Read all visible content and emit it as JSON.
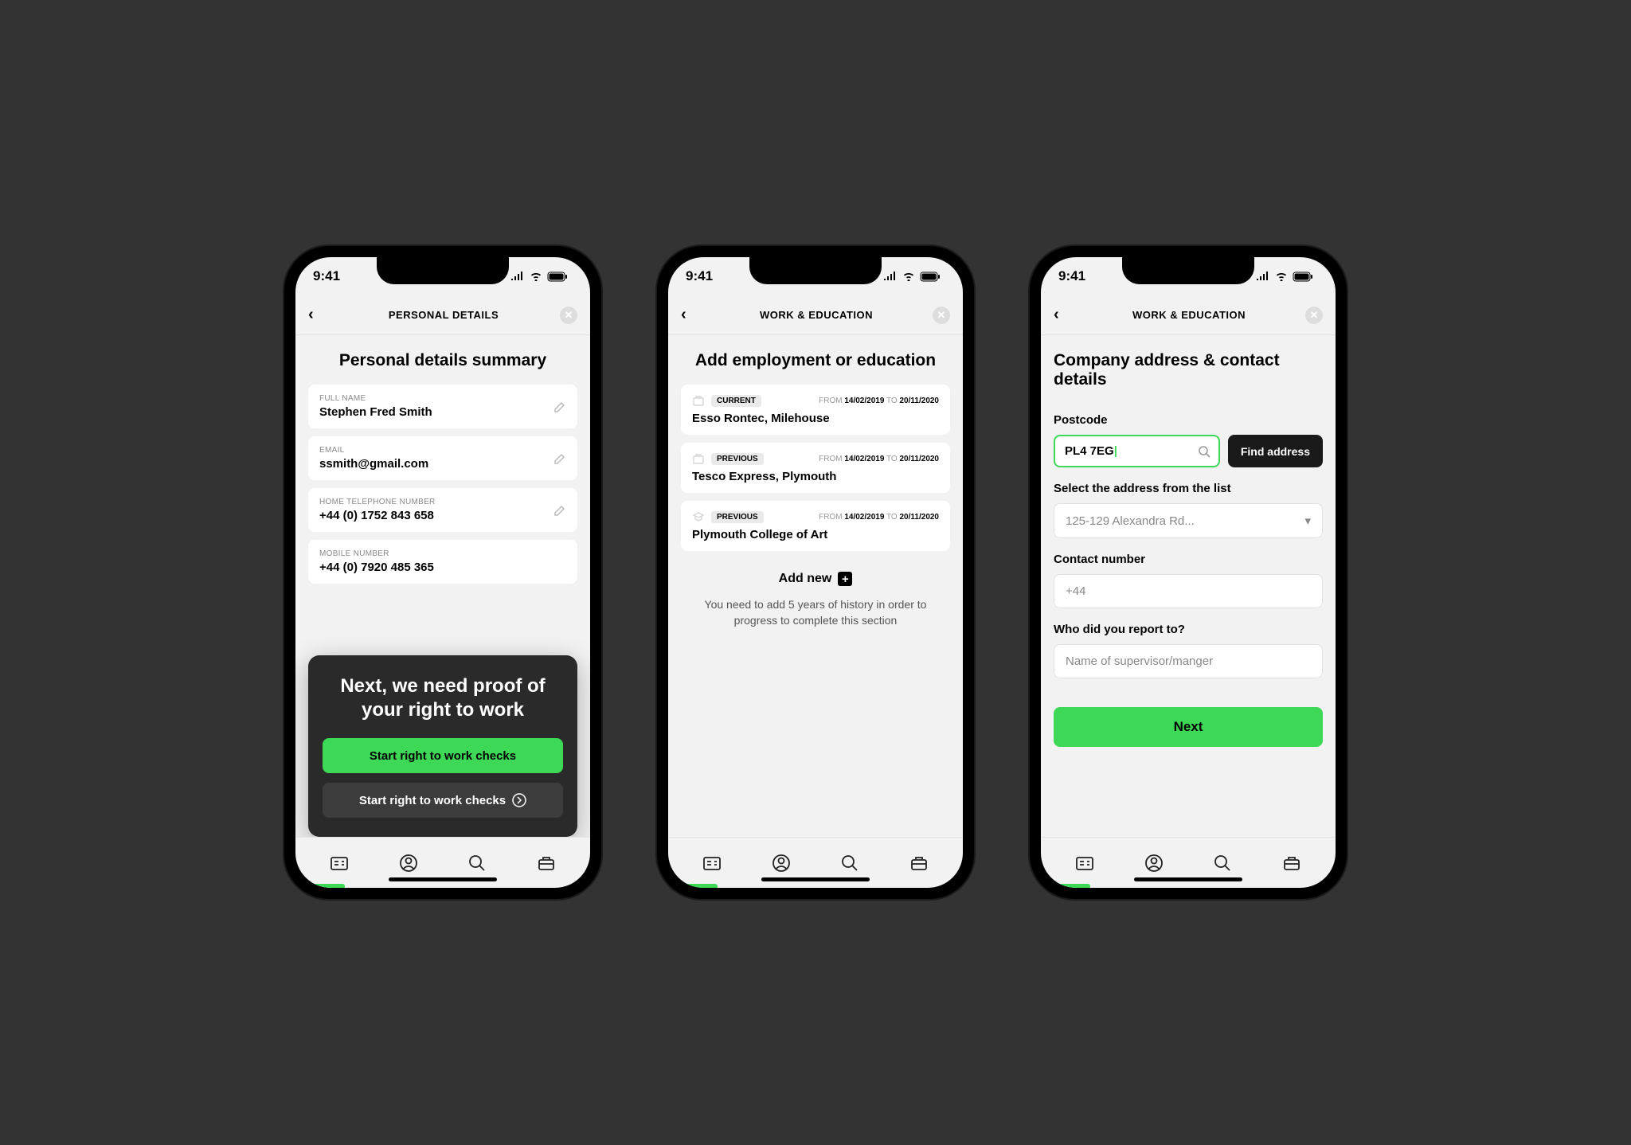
{
  "status_time": "9:41",
  "s1": {
    "nav": "PERSONAL DETAILS",
    "title": "Personal details summary",
    "fields": [
      {
        "label": "FULL NAME",
        "value": "Stephen Fred Smith"
      },
      {
        "label": "EMAIL",
        "value": "ssmith@gmail.com"
      },
      {
        "label": "HOME TELEPHONE NUMBER",
        "value": "+44 (0) 1752 843 658"
      },
      {
        "label": "MOBILE NUMBER",
        "value": "+44 (0) 7920 485 365"
      }
    ],
    "sheet_title": "Next, we need proof of your right to work",
    "sheet_btn1": "Start right to work checks",
    "sheet_btn2": "Start right to work checks"
  },
  "s2": {
    "nav": "WORK & EDUCATION",
    "title": "Add employment or education",
    "items": [
      {
        "badge": "CURRENT",
        "from": "14/02/2019",
        "to": "20/11/2020",
        "place": "Esso Rontec, Milehouse",
        "icon": "briefcase"
      },
      {
        "badge": "PREVIOUS",
        "from": "14/02/2019",
        "to": "20/11/2020",
        "place": "Tesco Express, Plymouth",
        "icon": "briefcase"
      },
      {
        "badge": "PREVIOUS",
        "from": "14/02/2019",
        "to": "20/11/2020",
        "place": "Plymouth College of Art",
        "icon": "education"
      }
    ],
    "addnew": "Add new",
    "note": "You need to add 5 years of history in order to progress to complete this section"
  },
  "s3": {
    "nav": "WORK & EDUCATION",
    "title": "Company address & contact details",
    "postcode_label": "Postcode",
    "postcode_value": "PL4 7EG",
    "find": "Find address",
    "select_label": "Select the address from the list",
    "select_value": "125-129 Alexandra Rd...",
    "contact_label": "Contact number",
    "contact_value": "+44",
    "report_label": "Who did you report to?",
    "report_placeholder": "Name of supervisor/manger",
    "next": "Next"
  }
}
